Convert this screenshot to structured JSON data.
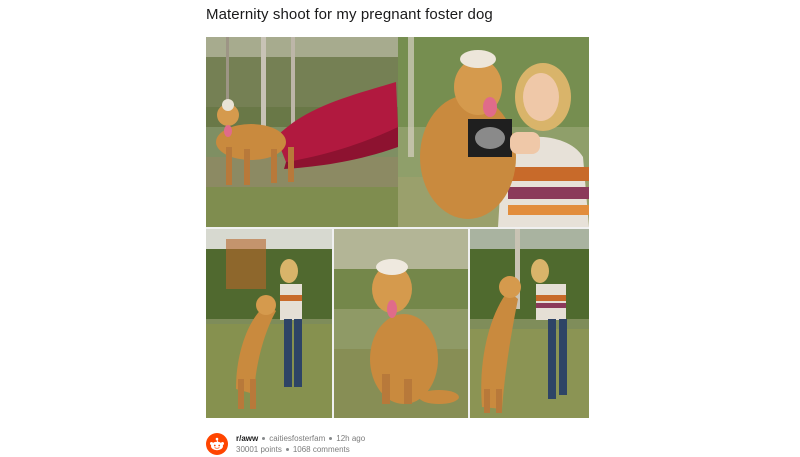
{
  "post": {
    "title": "Maternity shoot for my pregnant foster dog",
    "subreddit": "r/aww",
    "author": "caitiesfosterfam",
    "age": "12h ago",
    "points": "30001 points",
    "comments": "1068 comments"
  },
  "images": [
    {
      "icon": "dog-red-fabric-photo"
    },
    {
      "icon": "woman-dog-ultrasound-photo"
    },
    {
      "icon": "dog-jumping-woman-photo"
    },
    {
      "icon": "dog-sitting-flower-crown-photo"
    },
    {
      "icon": "dog-kissing-woman-photo"
    }
  ],
  "colors": {
    "subreddit_icon": "#ff4500",
    "fabric": "#b1193f",
    "dog": "#c98a3e",
    "grass": "#6f8a4a"
  }
}
